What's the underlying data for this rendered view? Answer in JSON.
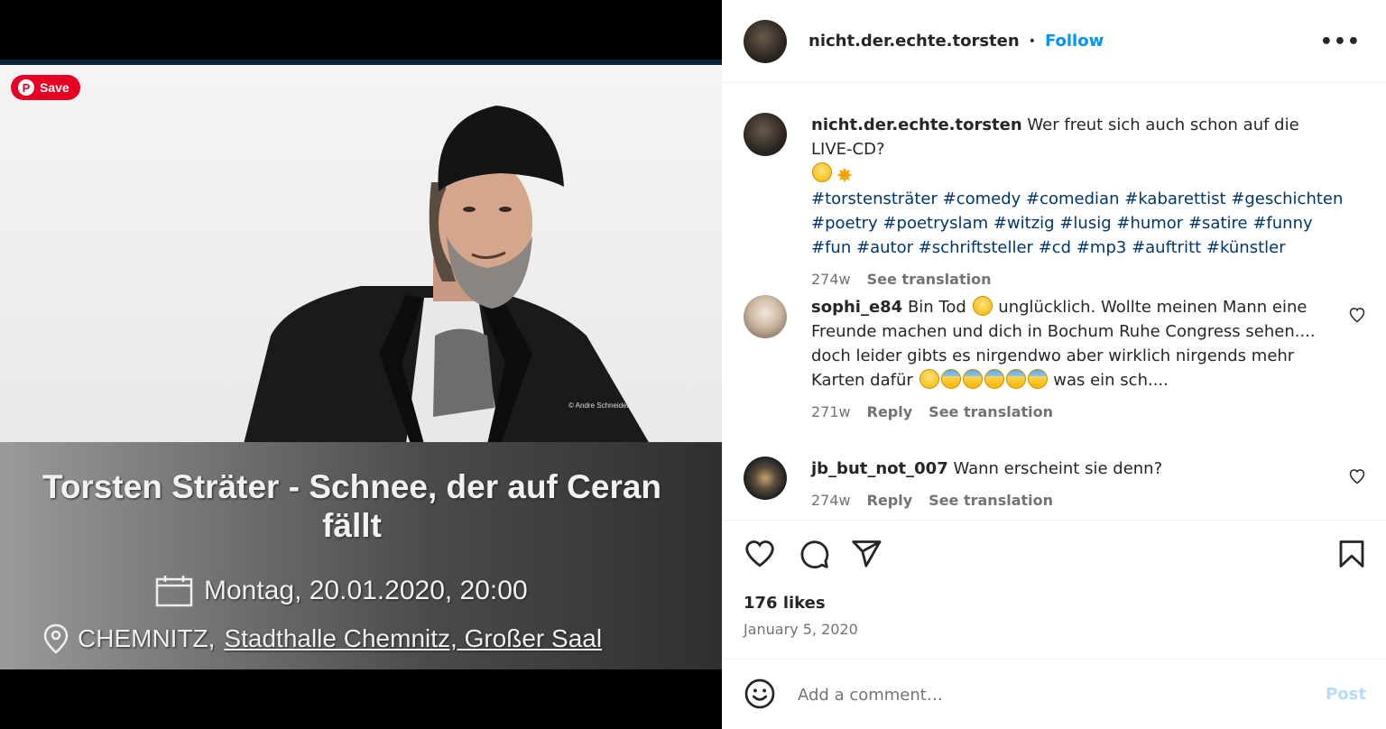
{
  "media": {
    "pin_save_label": "Save",
    "watermark": "© Andre Schneider",
    "banner": {
      "title_line1": "Torsten Sträter - Schnee, der auf Ceran",
      "title_line2": "fällt",
      "date": "Montag, 20.01.2020, 20:00",
      "location_city": "CHEMNITZ,",
      "location_venue": "Stadthalle Chemnitz, Großer Saal"
    }
  },
  "header": {
    "username": "nicht.der.echte.torsten",
    "separator": "•",
    "follow_label": "Follow",
    "more_label": "•••"
  },
  "caption": {
    "username": "nicht.der.echte.torsten",
    "text": "Wer freut sich auch schon auf die LIVE-CD?",
    "hashtags": [
      "#torstensträter",
      "#comedy",
      "#comedian",
      "#kabarettist",
      "#geschichten",
      "#poetry",
      "#poetryslam",
      "#witzig",
      "#lusig",
      "#humor",
      "#satire",
      "#funny",
      "#fun",
      "#autor",
      "#schriftsteller",
      "#cd",
      "#mp3",
      "#auftritt",
      "#künstler"
    ],
    "age": "274w",
    "translate": "See translation"
  },
  "comments": [
    {
      "username": "sophi_e84",
      "text_part1": "Bin Tod",
      "text_part2": "unglücklich. Wollte meinen Mann eine Freunde machen und dich in Bochum Ruhe Congress sehen.... doch leider gibts es nirgendwo aber wirklich nirgends mehr Karten dafür",
      "text_part3": "was ein sch....",
      "age": "271w",
      "reply": "Reply",
      "translate": "See translation"
    },
    {
      "username": "jb_but_not_007",
      "text": "Wann erscheint sie denn?",
      "age": "274w",
      "reply": "Reply",
      "translate": "See translation"
    }
  ],
  "footer": {
    "likes": "176 likes",
    "date": "January 5, 2020",
    "comment_placeholder": "Add a comment…",
    "post_label": "Post"
  },
  "icons": {
    "like": "heart-icon",
    "comment": "comment-icon",
    "share": "share-icon",
    "save": "bookmark-icon",
    "emoji": "smiley-icon",
    "calendar": "calendar-icon",
    "location": "location-pin-icon"
  },
  "colors": {
    "link": "#0095f6",
    "hashtag": "#00376b",
    "pinterest": "#e60023",
    "muted": "#737373"
  }
}
